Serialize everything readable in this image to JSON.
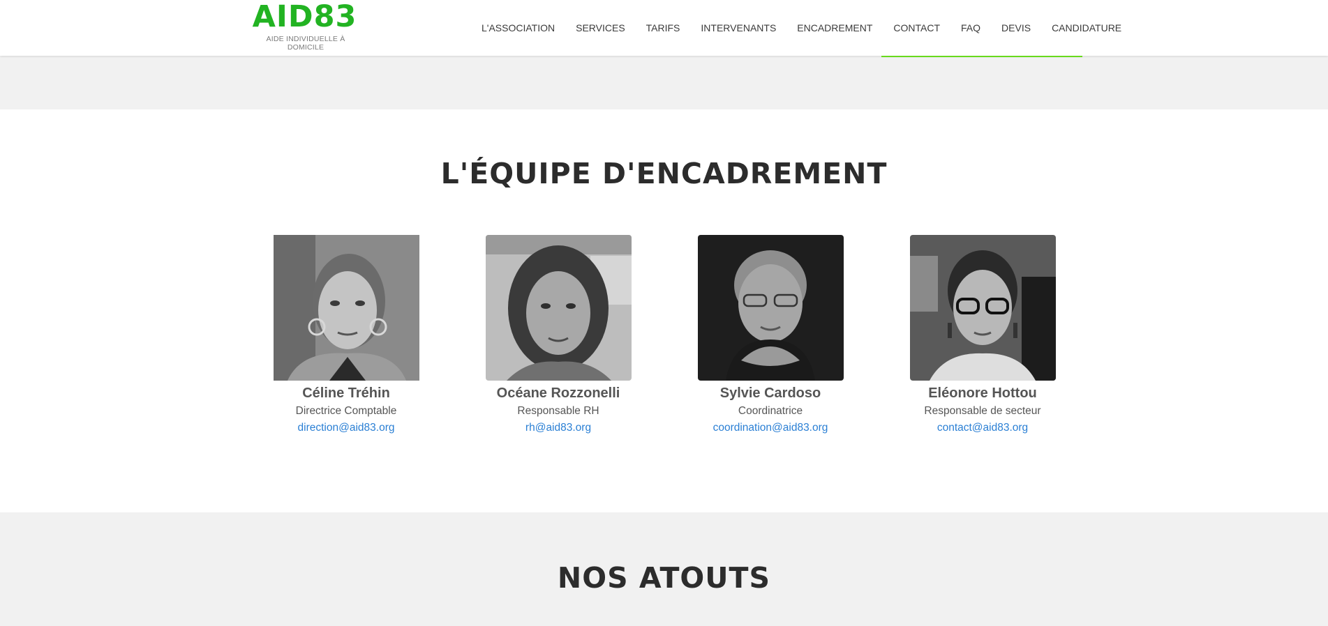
{
  "header": {
    "logo": {
      "title": "AID83",
      "subtitle": "AIDE INDIVIDUELLE À DOMICILE"
    },
    "nav": [
      {
        "label": "L'ASSOCIATION"
      },
      {
        "label": "SERVICES"
      },
      {
        "label": "TARIFS"
      },
      {
        "label": "INTERVENANTS"
      },
      {
        "label": "ENCADREMENT"
      },
      {
        "label": "CONTACT"
      },
      {
        "label": "FAQ"
      },
      {
        "label": "DEVIS"
      },
      {
        "label": "CANDIDATURE"
      }
    ]
  },
  "team": {
    "title": "L'ÉQUIPE D'ENCADREMENT",
    "members": [
      {
        "name": "Céline Tréhin",
        "role": "Directrice Comptable",
        "email": "direction@aid83.org"
      },
      {
        "name": "Océane Rozzonelli",
        "role": "Responsable RH",
        "email": "rh@aid83.org"
      },
      {
        "name": "Sylvie Cardoso",
        "role": "Coordinatrice",
        "email": "coordination@aid83.org"
      },
      {
        "name": "Eléonore Hottou",
        "role": "Responsable de secteur",
        "email": "contact@aid83.org"
      }
    ]
  },
  "atouts": {
    "title": "NOS ATOUTS"
  },
  "colors": {
    "brand_green": "#22b322",
    "accent_green": "#6fe81f",
    "link_blue": "#2a7fd4",
    "heading": "#2c2c2c",
    "band_gray": "#f1f1f1"
  }
}
